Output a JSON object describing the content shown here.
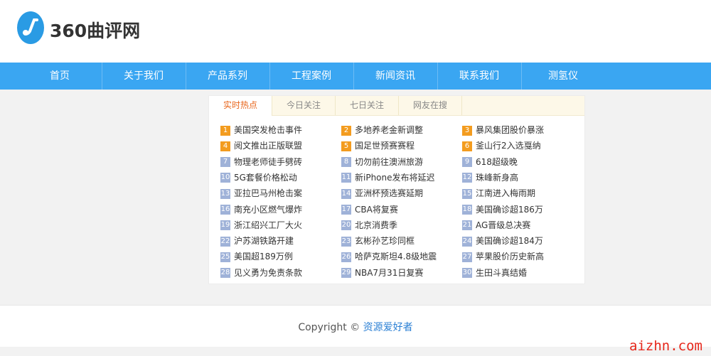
{
  "header": {
    "logo_text": "360曲评网",
    "brand_color": "#2a9be4"
  },
  "nav": {
    "items": [
      "首页",
      "关于我们",
      "产品系列",
      "工程案例",
      "新闻资讯",
      "联系我们",
      "测氢仪"
    ],
    "bg_color": "#3aa6f2"
  },
  "tabs": {
    "items": [
      "实时热点",
      "今日关注",
      "七日关注",
      "网友在搜"
    ],
    "active_index": 0,
    "active_color": "#e8661c"
  },
  "hot_list": [
    {
      "rank": "1",
      "title": "美国突发枪击事件"
    },
    {
      "rank": "2",
      "title": "多地养老金新调整"
    },
    {
      "rank": "3",
      "title": "暴风集团股价暴涨"
    },
    {
      "rank": "4",
      "title": "阅文推出正版联盟"
    },
    {
      "rank": "5",
      "title": "国足世预赛赛程"
    },
    {
      "rank": "6",
      "title": "釜山行2入选戛纳"
    },
    {
      "rank": "7",
      "title": "物理老师徒手劈砖"
    },
    {
      "rank": "8",
      "title": "切勿前往澳洲旅游"
    },
    {
      "rank": "9",
      "title": "618超级晚"
    },
    {
      "rank": "10",
      "title": "5G套餐价格松动"
    },
    {
      "rank": "11",
      "title": "新iPhone发布将延迟"
    },
    {
      "rank": "12",
      "title": "珠峰新身高"
    },
    {
      "rank": "13",
      "title": "亚拉巴马州枪击案"
    },
    {
      "rank": "14",
      "title": "亚洲杯预选赛延期"
    },
    {
      "rank": "15",
      "title": "江南进入梅雨期"
    },
    {
      "rank": "16",
      "title": "南充小区燃气爆炸"
    },
    {
      "rank": "17",
      "title": "CBA将复赛"
    },
    {
      "rank": "18",
      "title": "美国确诊超186万"
    },
    {
      "rank": "19",
      "title": "浙江绍兴工厂大火"
    },
    {
      "rank": "20",
      "title": "北京消费季"
    },
    {
      "rank": "21",
      "title": "AG晋级总决赛"
    },
    {
      "rank": "22",
      "title": "沪苏湖铁路开建"
    },
    {
      "rank": "23",
      "title": "玄彬孙艺珍同框"
    },
    {
      "rank": "24",
      "title": "美国确诊超184万"
    },
    {
      "rank": "25",
      "title": "美国超189万例"
    },
    {
      "rank": "26",
      "title": "哈萨克斯坦4.8级地震"
    },
    {
      "rank": "27",
      "title": "苹果股价历史新高"
    },
    {
      "rank": "28",
      "title": "见义勇为免责条款"
    },
    {
      "rank": "29",
      "title": "NBA7月31日复赛"
    },
    {
      "rank": "30",
      "title": "生田斗真结婚"
    }
  ],
  "footer": {
    "copyright_prefix": "Copyright © ",
    "copyright_link": "资源爱好者"
  },
  "watermark": "aizhn.com"
}
